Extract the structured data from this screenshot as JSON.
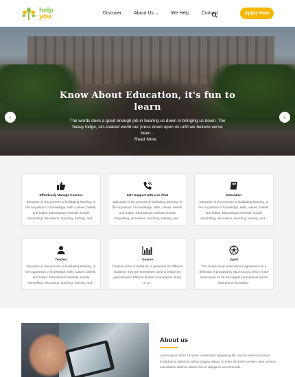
{
  "brand": {
    "line1": "help",
    "line2": "you",
    "accent": "#8bc34a",
    "accent2": "#f5b800"
  },
  "nav": {
    "items": [
      {
        "label": "Discover"
      },
      {
        "label": "About Us",
        "caret": "⌄"
      },
      {
        "label": "We Help"
      },
      {
        "label": "Contact"
      }
    ],
    "search_icon": "search-icon",
    "apply_label": "Apply Now",
    "apply_color": "#f7b600"
  },
  "hero": {
    "title": "Know About Education, it's fun to learn",
    "text": "The words does a good enough job in bearing us down in bringing us down. The heavy lodge, sin-soaked world our press down upon us until we believe we've been...",
    "button": "Read More",
    "prev_icon": "chevron-left-icon",
    "next_icon": "chevron-right-icon",
    "slides": 3,
    "active_slide": 1
  },
  "cards": [
    {
      "icon": "thumbs-up-icon",
      "title": "Effortlessly Manage Courses",
      "text": "Education is the process of facilitating learning, or the acquisition of knowledge, skills, values, beliefs, and habits. Educational methods include storytelling, discussion, teaching, training, and..."
    },
    {
      "icon": "phone-icon",
      "title": "24/7 Support with Live Chat",
      "text": "Education is the process of facilitating learning, or the acquisition of knowledge, skills, values, beliefs, and habits. Educational methods include storytelling, discussion, teaching, training, and..."
    },
    {
      "icon": "book-icon",
      "title": "Education",
      "text": "Education is the process of facilitating learning, or the acquisition of knowledge, skills, values, beliefs, and habits. Educational methods include storytelling, discussion, teaching, training, and..."
    },
    {
      "icon": "user-icon",
      "title": "Teacher",
      "text": "Education is the process of facilitating learning, or the acquisition of knowledge, skills, values, beliefs, and habits. Educational methods include storytelling, discussion, teaching, training, and..."
    },
    {
      "icon": "bar-chart-icon",
      "title": "Course",
      "text": "Courses serve a multitude of purposes for different students; they are sometimes used to bridge the gap between different phases of academic study, or to..."
    },
    {
      "icon": "soccer-ball-icon",
      "title": "Sport",
      "text": "The closest to an international agreement on a definition is provided by SportAccord, which is the association for all the largest international sports federations (including..."
    }
  ],
  "about": {
    "title": "About us",
    "text": "Lorem ipsum dolor sit amet, consectetur adipiscing elit, sed do eiusmod tempor incididunt ut labore et dolore magna aliqua. Ut enim ad minim veniam, quis nostrud exercitation ullamco laboris nisi ut aliquip ex ea commodo..."
  }
}
